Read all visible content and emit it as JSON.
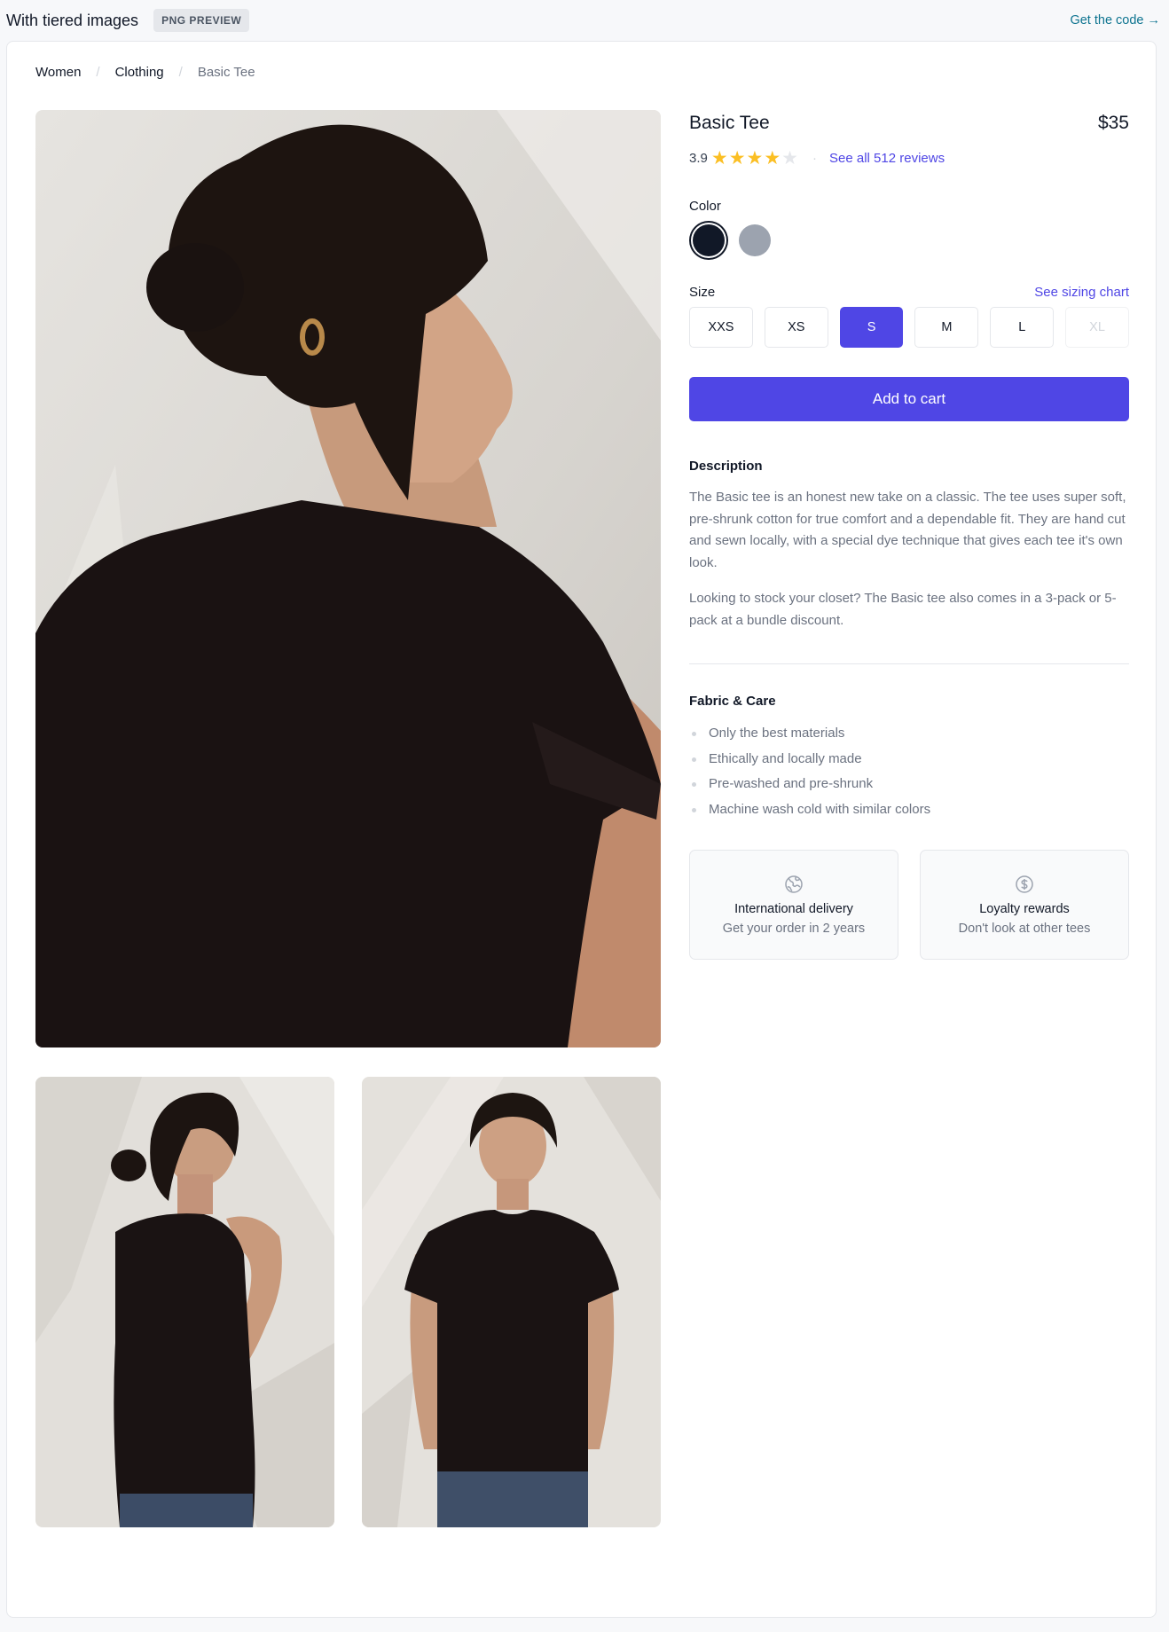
{
  "preview": {
    "title": "With tiered images",
    "badge": "PNG PREVIEW",
    "code_link": "Get the code",
    "code_arrow": "→"
  },
  "breadcrumb": {
    "items": [
      "Women",
      "Clothing"
    ],
    "separator": "/",
    "current": "Basic Tee"
  },
  "product": {
    "name": "Basic Tee",
    "price": "$35",
    "rating": "3.9",
    "stars_filled": 4,
    "stars_total": 5,
    "reviews_link": "See all 512 reviews",
    "rating_dot": "·"
  },
  "color": {
    "label": "Color",
    "options": [
      {
        "name": "Black",
        "hex": "#111827",
        "selected": true
      },
      {
        "name": "Heather Grey",
        "hex": "#9ca3af",
        "selected": false
      }
    ]
  },
  "size": {
    "label": "Size",
    "chart_link": "See sizing chart",
    "options": [
      "XXS",
      "XS",
      "S",
      "M",
      "L",
      "XL"
    ],
    "selected": "S",
    "disabled": [
      "XL"
    ]
  },
  "cart": {
    "label": "Add to cart"
  },
  "description": {
    "title": "Description",
    "paragraphs": [
      "The Basic tee is an honest new take on a classic. The tee uses super soft, pre-shrunk cotton for true comfort and a dependable fit. They are hand cut and sewn locally, with a special dye technique that gives each tee it's own look.",
      "Looking to stock your closet? The Basic tee also comes in a 3-pack or 5-pack at a bundle discount."
    ]
  },
  "fabric": {
    "title": "Fabric & Care",
    "items": [
      "Only the best materials",
      "Ethically and locally made",
      "Pre-washed and pre-shrunk",
      "Machine wash cold with similar colors"
    ]
  },
  "perks": [
    {
      "icon": "globe-icon",
      "title": "International delivery",
      "subtitle": "Get your order in 2 years"
    },
    {
      "icon": "dollar-circle-icon",
      "title": "Loyalty rewards",
      "subtitle": "Don't look at other tees"
    }
  ],
  "colors": {
    "accent": "#4f46e5",
    "link_code": "#0e7490",
    "star": "#fbbf24"
  }
}
